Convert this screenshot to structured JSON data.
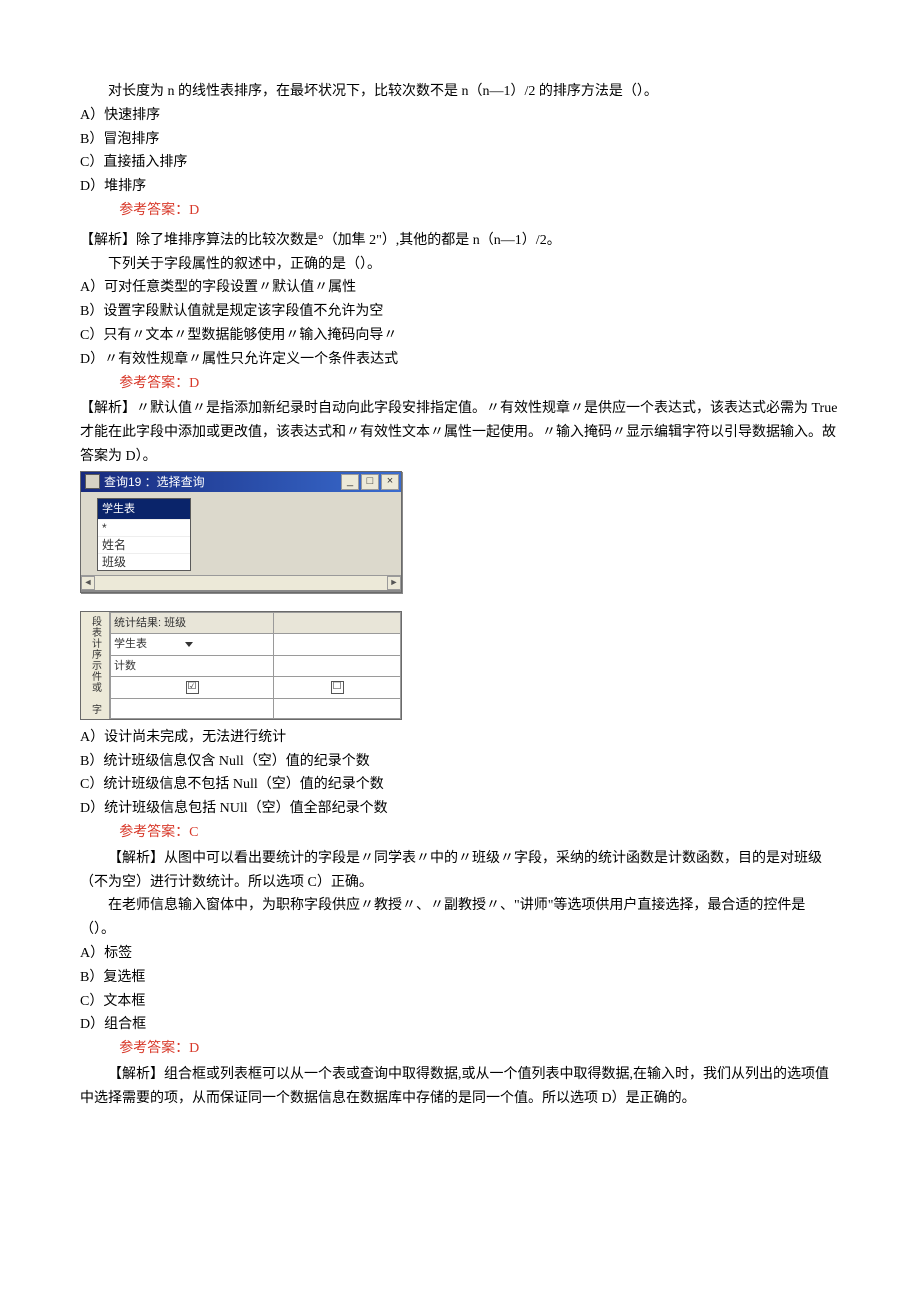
{
  "q1": {
    "stem": "对长度为 n 的线性表排序，在最坏状况下，比较次数不是 n（n—1）/2 的排序方法是（）。",
    "options": {
      "A": "A）快速排序",
      "B": "B）冒泡排序",
      "C": "C）直接插入排序",
      "D": "D）堆排序"
    },
    "answer": "参考答案：D",
    "analysis_label": "【解析】",
    "analysis": "除了堆排序算法的比较次数是°（加隼 2\"）,其他的都是 n（n—1）/2。"
  },
  "q2": {
    "stem": "下列关于字段属性的叙述中，正确的是（）。",
    "options": {
      "A": "A）可对任意类型的字段设置〃默认值〃属性",
      "B": "B）设置字段默认值就是规定该字段值不允许为空",
      "C": "C）只有〃文本〃型数据能够使用〃输入掩码向导〃",
      "D": "D）〃有效性规章〃属性只允许定义一个条件表达式"
    },
    "answer": "参考答案：D",
    "analysis_label": "【解析】",
    "analysis": "〃默认值〃是指添加新纪录时自动向此字段安排指定值。〃有效性规章〃是供应一个表达式，该表达式必需为 True 才能在此字段中添加或更改值，该表达式和〃有效性文本〃属性一起使用。〃输入掩码〃显示编辑字符以引导数据输入。故答案为 D）。"
  },
  "access_win": {
    "title": "查询19 ：选择查询",
    "table_title": "学生表",
    "fields": {
      "f1": "*",
      "f2": "姓名",
      "f3": "班级"
    },
    "row_labels": "段表计序示件或　字",
    "cell_r1c1": "统计结果: 班级",
    "cell_r2c1": "学生表",
    "cell_r3c1": "计数",
    "check_on": "☑",
    "check_off": "☐"
  },
  "q3": {
    "options": {
      "A": "A）设计尚未完成，无法进行统计",
      "B": "B）统计班级信息仅含 Null（空）值的纪录个数",
      "C": "C）统计班级信息不包括 Null（空）值的纪录个数",
      "D": "D）统计班级信息包括 NUll（空）值全部纪录个数"
    },
    "answer": "参考答案：C",
    "analysis_label": "【解析】",
    "analysis": "从图中可以看出要统计的字段是〃同学表〃中的〃班级〃字段，采纳的统计函数是计数函数，目的是对班级（不为空）进行计数统计。所以选项 C）正确。"
  },
  "q4": {
    "stem": "在老师信息输入窗体中，为职称字段供应〃教授〃、〃副教授〃、\"讲师\"等选项供用户直接选择，最合适的控件是（）。",
    "options": {
      "A": "A）标签",
      "B": "B）复选框",
      "C": "C）文本框",
      "D": "D）组合框"
    },
    "answer": "参考答案：D",
    "analysis_label": "【解析】",
    "analysis": "组合框或列表框可以从一个表或查询中取得数据,或从一个值列表中取得数据,在输入时，我们从列出的选项值中选择需要的项，从而保证同一个数据信息在数据库中存储的是同一个值。所以选项 D）是正确的。"
  }
}
